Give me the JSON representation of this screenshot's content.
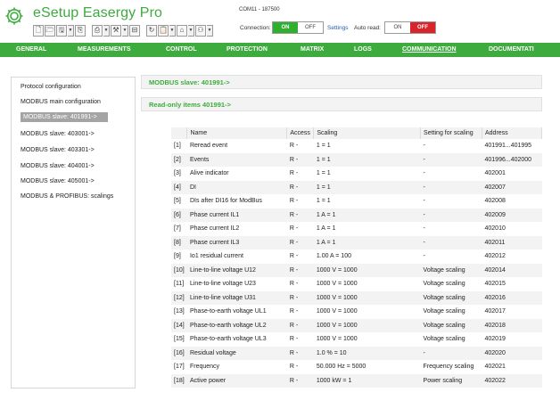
{
  "app": {
    "title": "eSetup Easergy Pro"
  },
  "toolbar": {
    "buttons": [
      {
        "icon": "new-file-icon",
        "glyph": "🗋"
      },
      {
        "icon": "open-folder-icon",
        "glyph": "🗁"
      },
      {
        "icon": "save-icon",
        "glyph": "🖫"
      },
      {
        "icon": "clipboard-icon",
        "glyph": "⎘"
      },
      {
        "icon": "print-icon",
        "glyph": "⎙"
      },
      {
        "icon": "tools-icon",
        "glyph": "⚒"
      },
      {
        "icon": "mimic-icon",
        "glyph": "⊟"
      },
      {
        "icon": "refresh-icon",
        "glyph": "↻"
      },
      {
        "icon": "report-icon",
        "glyph": "📋"
      },
      {
        "icon": "device-icon",
        "glyph": "⌂"
      },
      {
        "icon": "user-icon",
        "glyph": "⚇"
      }
    ]
  },
  "connection": {
    "com_label": "COM11 - 187500",
    "label": "Connection:",
    "on": "ON",
    "off": "OFF",
    "settings": "Settings",
    "autoread_label": "Auto read:",
    "autoread_on": "ON",
    "autoread_off": "OFF"
  },
  "menu": [
    {
      "label": "GENERAL"
    },
    {
      "label": "MEASUREMENTS"
    },
    {
      "label": "CONTROL"
    },
    {
      "label": "PROTECTION"
    },
    {
      "label": "MATRIX"
    },
    {
      "label": "LOGS"
    },
    {
      "label": "COMMUNICATION",
      "active": true
    },
    {
      "label": "DOCUMENTATI"
    }
  ],
  "sidebar": {
    "items": [
      {
        "label": "Protocol configuration"
      },
      {
        "label": "MODBUS main configuration"
      },
      {
        "label": "MODBUS slave: 401991->",
        "selected": true
      },
      {
        "label": "MODBUS slave: 403001->"
      },
      {
        "label": "MODBUS slave: 403301->"
      },
      {
        "label": "MODBUS slave: 404001->"
      },
      {
        "label": "MODBUS slave: 405001->"
      },
      {
        "label": "MODBUS & PROFIBUS: scalings"
      }
    ]
  },
  "main": {
    "section_title": "MODBUS slave: 401991->",
    "subsection_title": "Read-only items 401991->",
    "columns": [
      "Name",
      "Access",
      "Scaling",
      "Setting for scaling",
      "Address"
    ],
    "rows": [
      [
        "[1]",
        "Reread event",
        "R -",
        "1 = 1",
        "-",
        "401991...401995"
      ],
      [
        "[2]",
        "Events",
        "R -",
        "1 = 1",
        "-",
        "401996...402000"
      ],
      [
        "[3]",
        "Alive indicator",
        "R -",
        "1 = 1",
        "-",
        "402001"
      ],
      [
        "[4]",
        "DI",
        "R -",
        "1 = 1",
        "-",
        "402007"
      ],
      [
        "[5]",
        "DIs after DI16 for ModBus",
        "R -",
        "1 = 1",
        "-",
        "402008"
      ],
      [
        "[6]",
        "Phase current IL1",
        "R -",
        "1 A = 1",
        "-",
        "402009"
      ],
      [
        "[7]",
        "Phase current IL2",
        "R -",
        "1 A = 1",
        "-",
        "402010"
      ],
      [
        "[8]",
        "Phase current IL3",
        "R -",
        "1 A = 1",
        "-",
        "402011"
      ],
      [
        "[9]",
        "Io1 residual current",
        "R -",
        "1.00 A = 100",
        "-",
        "402012"
      ],
      [
        "[10]",
        "Line-to-line voltage U12",
        "R -",
        "1000 V = 1000",
        "Voltage scaling",
        "402014"
      ],
      [
        "[11]",
        "Line-to-line voltage U23",
        "R -",
        "1000 V = 1000",
        "Voltage scaling",
        "402015"
      ],
      [
        "[12]",
        "Line-to-line voltage U31",
        "R -",
        "1000 V = 1000",
        "Voltage scaling",
        "402016"
      ],
      [
        "[13]",
        "Phase-to-earth voltage UL1",
        "R -",
        "1000 V = 1000",
        "Voltage scaling",
        "402017"
      ],
      [
        "[14]",
        "Phase-to-earth voltage UL2",
        "R -",
        "1000 V = 1000",
        "Voltage scaling",
        "402018"
      ],
      [
        "[15]",
        "Phase-to-earth voltage UL3",
        "R -",
        "1000 V = 1000",
        "Voltage scaling",
        "402019"
      ],
      [
        "[16]",
        "Residual voltage",
        "R -",
        "1.0 % = 10",
        "-",
        "402020"
      ],
      [
        "[17]",
        "Frequency",
        "R -",
        "50.000 Hz = 5000",
        "Frequency scaling",
        "402021"
      ],
      [
        "[18]",
        "Active power",
        "R -",
        "1000 kW = 1",
        "Power scaling",
        "402022"
      ]
    ]
  },
  "colors": {
    "brand_green": "#3dab3d",
    "on_green": "#2fae2f",
    "off_red": "#d7252b",
    "selected_gray": "#a4a4a4"
  }
}
